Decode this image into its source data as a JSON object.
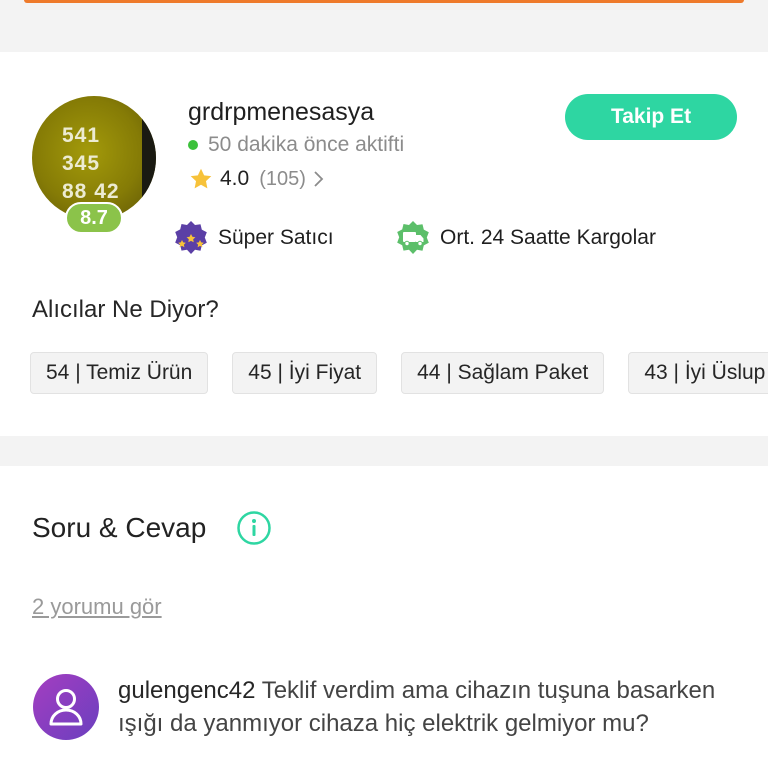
{
  "seller": {
    "avatar_lines": [
      "541",
      "345",
      "88 42"
    ],
    "score": "8.7",
    "name": "grdrpmenesasya",
    "status": "50 dakika önce aktifti",
    "rating": "4.0",
    "rating_count": "(105)",
    "follow_label": "Takip Et",
    "badges": [
      {
        "icon": "super-seller-icon",
        "label": "Süper Satıcı"
      },
      {
        "icon": "truck-icon",
        "label": "Ort. 24 Saatte Kargolar"
      }
    ]
  },
  "buyer_feedback": {
    "title": "Alıcılar Ne Diyor?",
    "chips": [
      "54 | Temiz Ürün",
      "45 | İyi Fiyat",
      "44 | Sağlam Paket",
      "43 | İyi Üslup"
    ]
  },
  "qa": {
    "title": "Soru & Cevap",
    "see_comments": "2 yorumu gör",
    "comment": {
      "user": "gulengenc42",
      "text": "Teklif verdim ama cihazın tuşuna basarken ışığı da yanmıyor cihaza hiç elektrik gelmiyor mu?"
    }
  },
  "colors": {
    "accent": "#2ed6a2",
    "top_bar": "#ee7a2b",
    "score_badge": "#8bc34a",
    "online": "#3cc13b"
  }
}
